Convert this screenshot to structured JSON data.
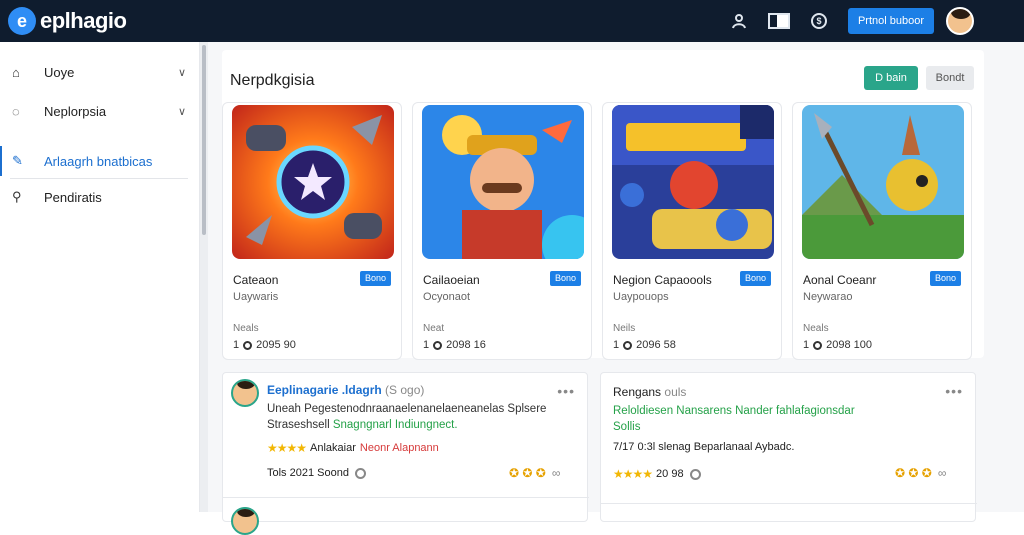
{
  "brand": {
    "logo_letter": "e",
    "name": "eplhagio"
  },
  "topbar": {
    "user_icon": "user-icon",
    "flag_icon": "flag-icon",
    "info_icon": "info-icon",
    "info_glyph": "$",
    "cta_label": "Prtnol buboor",
    "avatar_icon": "avatar"
  },
  "sidebar": {
    "items": [
      {
        "label": "Uoye",
        "icon": "folder-icon",
        "glyph": "⌂",
        "expandable": true
      },
      {
        "label": "Neplorpsia",
        "icon": "settings-icon",
        "glyph": "◌",
        "expandable": true
      },
      {
        "label": "Arlaagrh bnatbicas",
        "icon": "pen-icon",
        "glyph": "✎",
        "active": true
      },
      {
        "label": "Pendiratis",
        "icon": "user-add-icon",
        "glyph": "⚲"
      }
    ]
  },
  "panel": {
    "title": "Nerpdkgisia",
    "primary_button": "D bain",
    "secondary_button": "Bondt"
  },
  "games": [
    {
      "name": "Cateaon",
      "badge": "Bono",
      "subtitle": "Uaywaris",
      "label": "Neals",
      "stats_a": "1",
      "stats_b": "2095 90"
    },
    {
      "name": "Cailaoeian",
      "badge": "Bono",
      "subtitle": "Ocyonaot",
      "label": "Neat",
      "stats_a": "1",
      "stats_b": "2098 16"
    },
    {
      "name": "Negion Capaoools",
      "badge": "Bono",
      "subtitle": "Uaypouops",
      "label": "Neils",
      "stats_a": "1",
      "stats_b": "2096 58"
    },
    {
      "name": "Aonal Coeanr",
      "badge": "Bono",
      "subtitle": "Neywarao",
      "label": "Neals",
      "stats_a": "1",
      "stats_b": "2098 100"
    }
  ],
  "reviews": [
    {
      "title": "Eeplinagarie .ldagrh",
      "tag": "(S ogo)",
      "body_line1": "Uneah Pegestenodnraanaelenanelaeneanelas Splsere",
      "body_line2_prefix": "Straseshsell ",
      "body_line2_highlight": "Snagngnarl Indiungnect.",
      "rating_prefix": "Anlakaiar ",
      "rating_red": "Neonr Alapnann",
      "foot": "Tols 2021 Soond",
      "reactions": "✪ ✪ ✪"
    },
    {
      "title": "Rengans",
      "tag": "ouls",
      "body_line1": "Reloldiesen Nansarens Nander fahlafagionsdar",
      "body_line2_prefix": "",
      "body_line2_highlight": "Sollis",
      "rating_prefix": "7/17 0:3l slenag Beparlanaal Aybadc.",
      "rating_red": "",
      "foot": "20 98",
      "reactions": "✪ ✪ ✪"
    }
  ]
}
